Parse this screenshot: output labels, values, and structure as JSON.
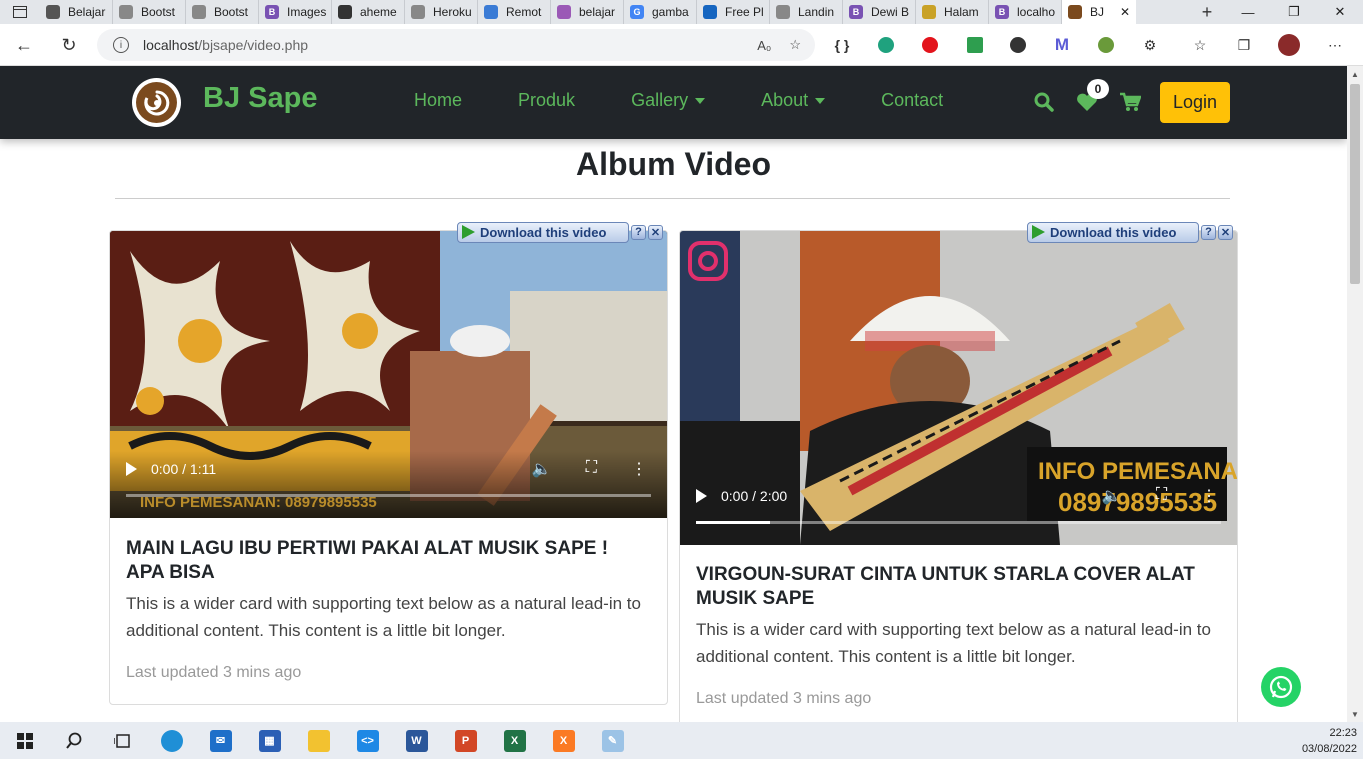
{
  "browser": {
    "tabs": [
      {
        "label": "Belajar",
        "color": "#555"
      },
      {
        "label": "Bootst",
        "color": "#888"
      },
      {
        "label": "Bootst",
        "color": "#888"
      },
      {
        "label": "Images",
        "color": "#7952b3",
        "glyph": "B"
      },
      {
        "label": "aheme",
        "color": "#333"
      },
      {
        "label": "Heroku",
        "color": "#888"
      },
      {
        "label": "Remot",
        "color": "#3a7bd5"
      },
      {
        "label": "belajar",
        "color": "#9b59b6"
      },
      {
        "label": "gamba",
        "color": "#4285f4",
        "glyph": "G"
      },
      {
        "label": "Free Pl",
        "color": "#1565c0"
      },
      {
        "label": "Landin",
        "color": "#888"
      },
      {
        "label": "Dewi B",
        "color": "#7952b3",
        "glyph": "B"
      },
      {
        "label": "Halam",
        "color": "#c9a227"
      },
      {
        "label": "localho",
        "color": "#7952b3",
        "glyph": "B"
      },
      {
        "label": "BJ",
        "color": "#7b4a1e",
        "active": true
      }
    ],
    "url_host": "localhost",
    "url_path": "/bjsape/video.php"
  },
  "site": {
    "brand": "BJ Sape",
    "nav": {
      "home": "Home",
      "produk": "Produk",
      "gallery": "Gallery",
      "about": "About",
      "contact": "Contact"
    },
    "wishlist_count": "0",
    "login": "Login"
  },
  "page": {
    "title": "Album Video"
  },
  "download_label": "Download this video",
  "videos": [
    {
      "time": "0:00 / 1:11",
      "progress": 0,
      "title": "MAIN LAGU IBU PERTIWI PAKAI ALAT MUSIK SAPE ! APA BISA",
      "text": "This is a wider card with supporting text below as a natural lead-in to additional content. This content is a little bit longer.",
      "updated": "Last updated 3 mins ago",
      "overlay": "INFO PEMESANAN: 08979895535"
    },
    {
      "time": "0:00 / 2:00",
      "progress": 0.14,
      "title": "VIRGOUN-SURAT CINTA UNTUK STARLA COVER ALAT MUSIK SAPE",
      "text": "This is a wider card with supporting text below as a natural lead-in to additional content. This content is a little bit longer.",
      "updated": "Last updated 3 mins ago",
      "overlay_line1": "INFO PEMESANAN:",
      "overlay_line2": "08979895535"
    }
  ],
  "taskbar": {
    "time": "22:23",
    "date": "03/08/2022"
  }
}
